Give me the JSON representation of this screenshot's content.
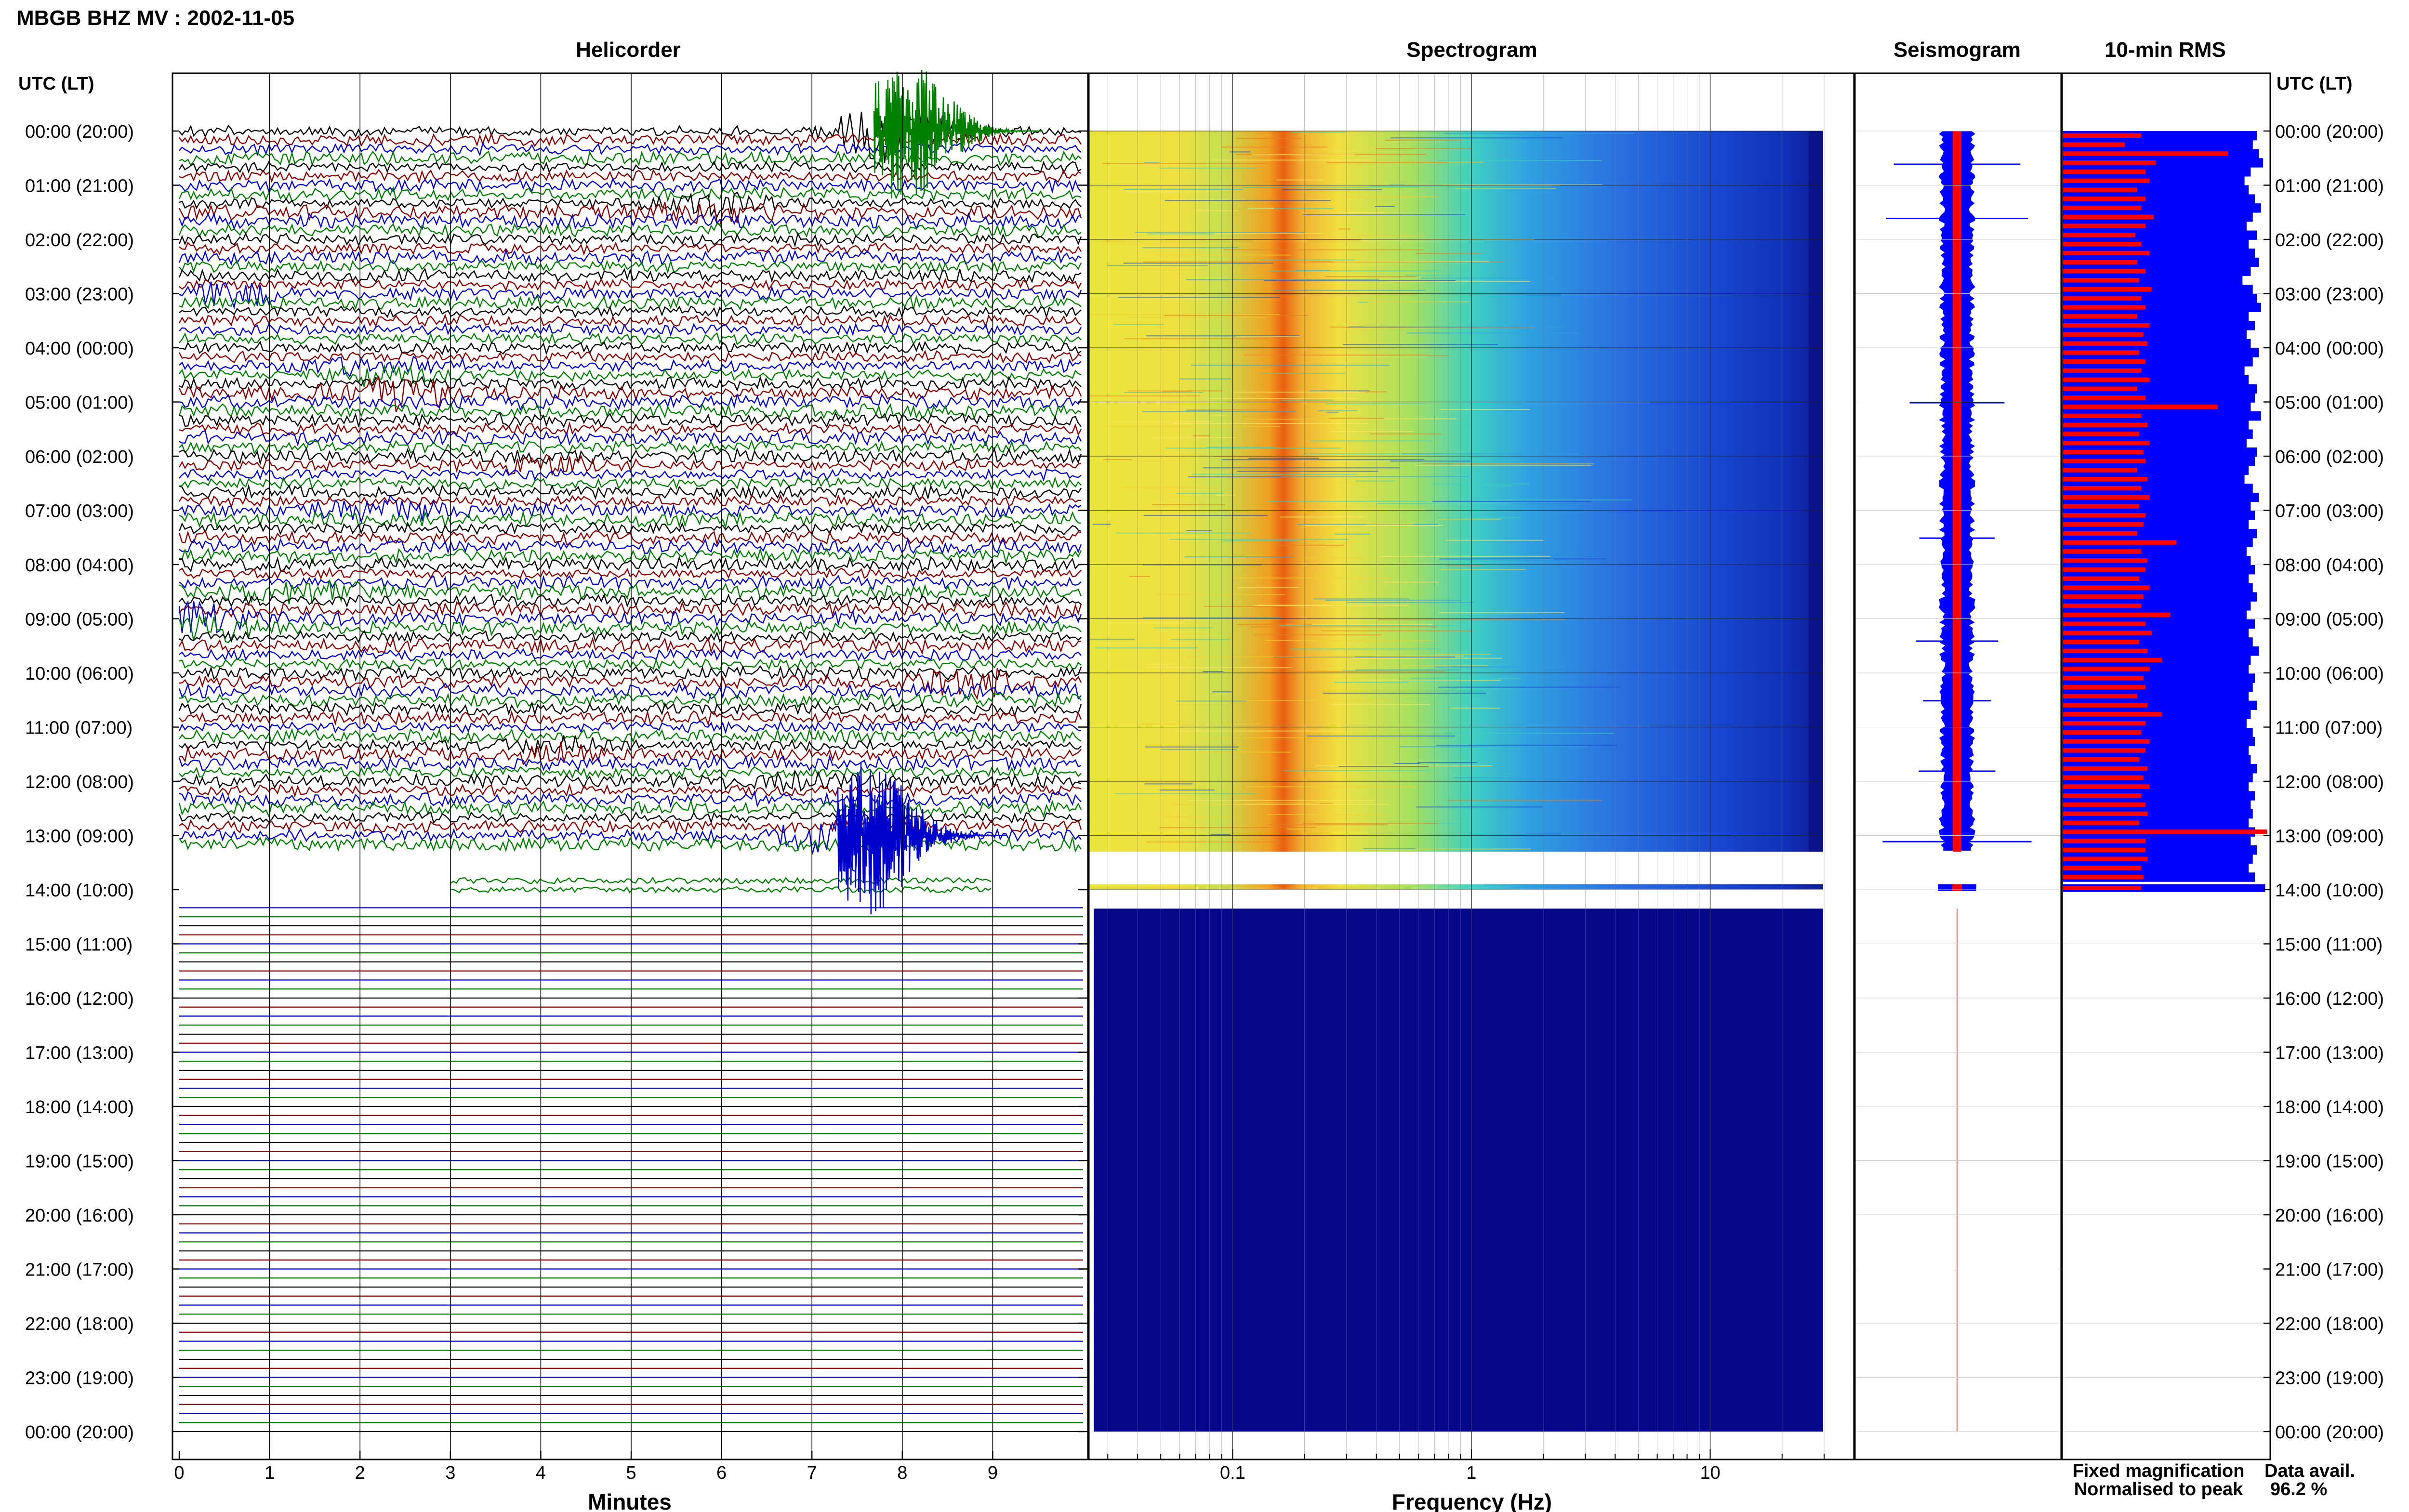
{
  "header": {
    "title": "MBGB BHZ MV : 2002-11-05",
    "utc_label_left": "UTC (LT)",
    "utc_label_right": "UTC (LT)"
  },
  "panels": {
    "helicorder": "Helicorder",
    "spectrogram": "Spectrogram",
    "seismogram": "Seismogram",
    "rms": "10-min RMS"
  },
  "axes": {
    "minutes_label": "Minutes",
    "frequency_label": "Frequency (Hz)"
  },
  "legend": {
    "fixed": "Fixed magnification",
    "normalised": "Normalised to peak",
    "fixed_color": "#0000ff",
    "normalised_color": "#ff0000"
  },
  "availability": {
    "label": "Data avail.",
    "value": "96.2 %"
  },
  "chart_data": {
    "type": "heatmap",
    "time_ticks": [
      "00:00 (20:00)",
      "01:00 (21:00)",
      "02:00 (22:00)",
      "03:00 (23:00)",
      "04:00 (00:00)",
      "05:00 (01:00)",
      "06:00 (02:00)",
      "07:00 (03:00)",
      "08:00 (04:00)",
      "09:00 (05:00)",
      "10:00 (06:00)",
      "11:00 (07:00)",
      "12:00 (08:00)",
      "13:00 (09:00)",
      "14:00 (10:00)",
      "15:00 (11:00)",
      "16:00 (12:00)",
      "17:00 (13:00)",
      "18:00 (14:00)",
      "19:00 (15:00)",
      "20:00 (16:00)",
      "21:00 (17:00)",
      "22:00 (18:00)",
      "23:00 (19:00)",
      "00:00 (20:00)"
    ],
    "minute_ticks": [
      "0",
      "1",
      "2",
      "3",
      "4",
      "5",
      "6",
      "7",
      "8",
      "9"
    ],
    "frequency_ticks": [
      {
        "value": 0.1,
        "label": "0.1"
      },
      {
        "value": 1,
        "label": "1"
      },
      {
        "value": 10,
        "label": "10"
      }
    ],
    "frequency_range": [
      0.025,
      40
    ],
    "minutes_range": [
      0,
      10
    ],
    "hours_range": [
      0,
      24
    ],
    "data_end_hour": 14.1,
    "trace_colors": [
      "#000000",
      "#8b0000",
      "#0000cd",
      "#008000"
    ],
    "helicorder_events": [
      {
        "hour": 0.0,
        "minute": 7.9,
        "amp": 5,
        "color": "#008000"
      },
      {
        "hour": 1.4,
        "minute": 6.0,
        "amp": 1.6,
        "color": "#8b0000"
      },
      {
        "hour": 3.0,
        "minute": 0.6,
        "amp": 1.3,
        "color": "#008000"
      },
      {
        "hour": 4.4,
        "minute": 2.2,
        "amp": 1.2,
        "color": "#8b0000"
      },
      {
        "hour": 4.8,
        "minute": 2.4,
        "amp": 2.6,
        "color": "#8b0000"
      },
      {
        "hour": 6.2,
        "minute": 4.0,
        "amp": 1.0,
        "color": "#0000cd"
      },
      {
        "hour": 7.0,
        "minute": 2.2,
        "amp": 1.4,
        "color": "#8b0000"
      },
      {
        "hour": 8.5,
        "minute": 1.4,
        "amp": 1.2,
        "color": "#0000cd"
      },
      {
        "hour": 9.1,
        "minute": 0.2,
        "amp": 2.0,
        "color": "#000000"
      },
      {
        "hour": 10.2,
        "minute": 8.8,
        "amp": 1.8,
        "color": "#0000cd"
      },
      {
        "hour": 11.4,
        "minute": 4.2,
        "amp": 1.0,
        "color": "#000000"
      },
      {
        "hour": 12.0,
        "minute": 6.8,
        "amp": 1.0,
        "color": "#8b0000"
      },
      {
        "hour": 13.0,
        "minute": 7.5,
        "amp": 5.5,
        "color": "#0000cd"
      }
    ],
    "rms_fixed": [
      0.94,
      0.92,
      0.95,
      0.97,
      0.91,
      0.88,
      0.9,
      0.93,
      0.96,
      0.92,
      0.89,
      0.94,
      0.9,
      0.93,
      0.95,
      0.91,
      0.87,
      0.92,
      0.94,
      0.96,
      0.9,
      0.93,
      0.89,
      0.91,
      0.95,
      0.92,
      0.88,
      0.9,
      0.94,
      0.93,
      0.91,
      0.96,
      0.9,
      0.92,
      0.89,
      0.94,
      0.93,
      0.9,
      0.88,
      0.92,
      0.95,
      0.91,
      0.93,
      0.9,
      0.94,
      0.92,
      0.89,
      0.91,
      0.93,
      0.9,
      0.92,
      0.94,
      0.91,
      0.89,
      0.93,
      0.9,
      0.92,
      0.95,
      0.91,
      0.9,
      0.93,
      0.92,
      0.9,
      0.94,
      0.91,
      0.89,
      0.92,
      0.93,
      0.9,
      0.91,
      0.94,
      0.92,
      0.9,
      0.93,
      0.91,
      0.92,
      0.9,
      0.93,
      0.91,
      0.94,
      0.92,
      0.9,
      0.93
    ],
    "rms_normalised": [
      0.38,
      0.3,
      0.8,
      0.45,
      0.4,
      0.42,
      0.36,
      0.4,
      0.38,
      0.44,
      0.4,
      0.35,
      0.38,
      0.42,
      0.36,
      0.4,
      0.37,
      0.43,
      0.38,
      0.4,
      0.36,
      0.42,
      0.39,
      0.41,
      0.37,
      0.4,
      0.38,
      0.42,
      0.36,
      0.4,
      0.75,
      0.38,
      0.41,
      0.37,
      0.42,
      0.39,
      0.4,
      0.36,
      0.41,
      0.38,
      0.42,
      0.37,
      0.4,
      0.39,
      0.36,
      0.55,
      0.38,
      0.41,
      0.4,
      0.37,
      0.42,
      0.39,
      0.38,
      0.52,
      0.4,
      0.43,
      0.37,
      0.41,
      0.48,
      0.42,
      0.39,
      0.4,
      0.36,
      0.41,
      0.48,
      0.4,
      0.38,
      0.42,
      0.4,
      0.37,
      0.41,
      0.39,
      0.42,
      0.38,
      0.4,
      0.41,
      0.37,
      0.99,
      0.4,
      0.4,
      0.41,
      0.38,
      0.39
    ]
  }
}
